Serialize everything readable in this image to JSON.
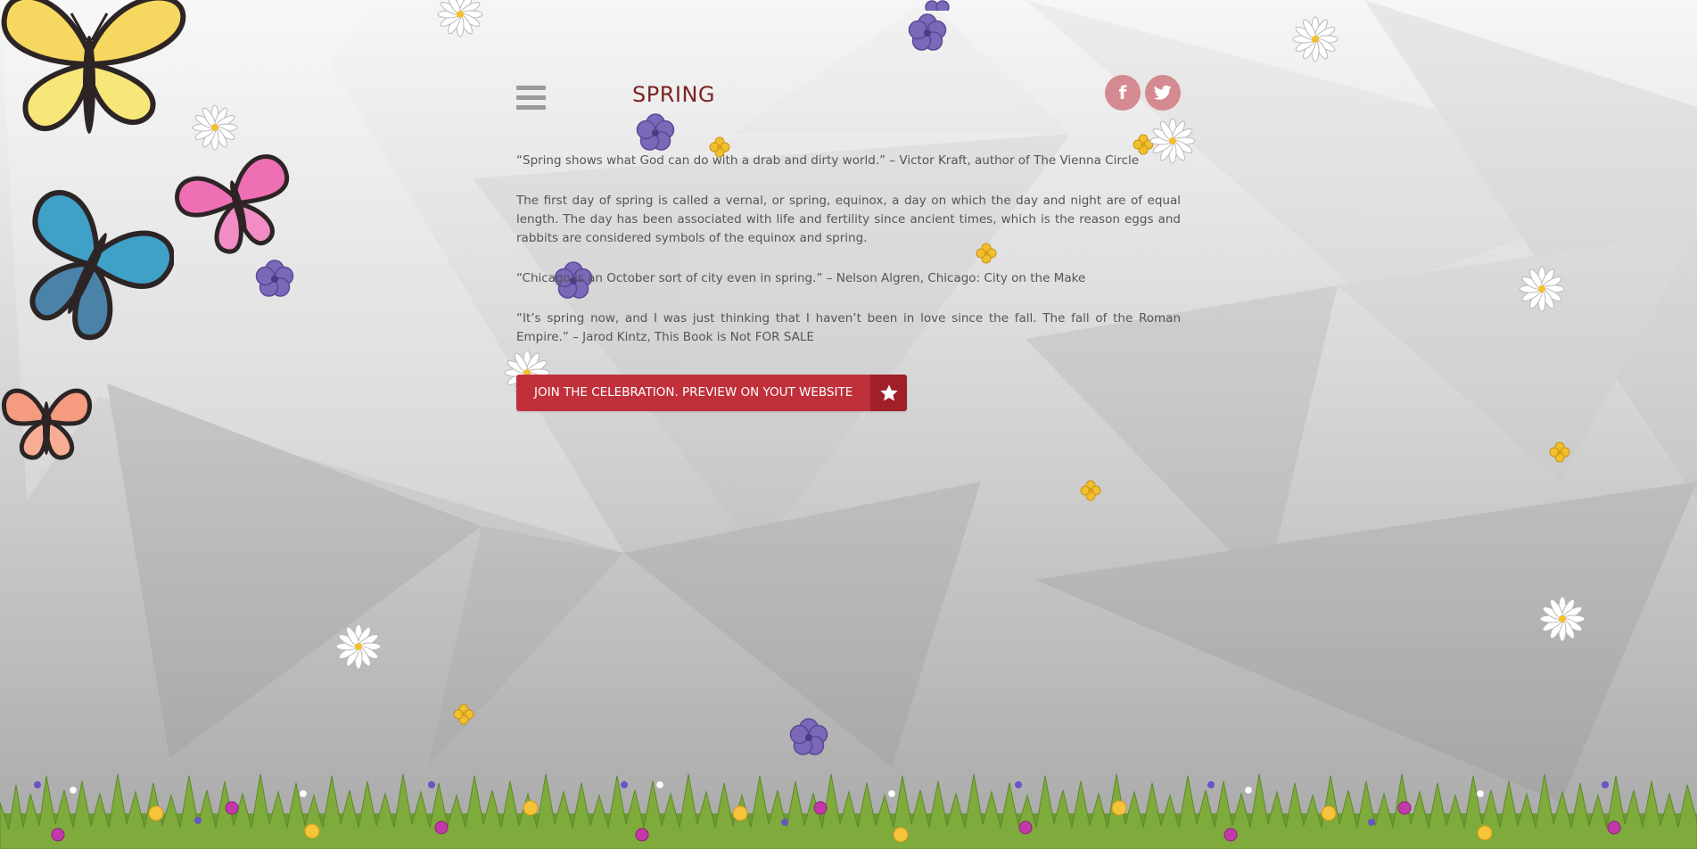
{
  "header": {
    "title": "SPRING",
    "menu_icon": "hamburger-menu-icon",
    "social": [
      {
        "name": "facebook",
        "icon": "facebook-icon",
        "glyph": "f"
      },
      {
        "name": "twitter",
        "icon": "twitter-icon"
      }
    ]
  },
  "content": {
    "paragraphs": [
      "“Spring shows what God can do with a drab and dirty world.” – Victor Kraft, author of The Vienna Circle",
      "The first day of spring is called a vernal, or spring, equinox, a day on which the day and night are of equal length. The day has been associated with life and fertility since ancient times, which is the reason eggs and rabbits are considered symbols of the equinox and spring.",
      "“Chicago is an October sort of city even in spring.” – Nelson Algren, Chicago: City on the Make",
      "“It’s spring now, and I was just thinking that I haven’t been in love since the fall. The fall of the Roman Empire.” – Jarod Kintz, This Book is Not FOR SALE"
    ]
  },
  "cta": {
    "label": "JOIN THE CELEBRATION. PREVIEW ON YOUT WEBSITE",
    "icon": "star-icon"
  },
  "colors": {
    "title": "#7a2424",
    "social_bg": "#d48a90",
    "cta_bg": "#c0303b",
    "cta_icon_bg": "#a01f29",
    "grass": "#6e9a34"
  },
  "decorations": {
    "butterflies": [
      "yellow-butterfly-icon",
      "pink-butterfly-icon",
      "blue-butterfly-icon",
      "orange-butterfly-icon"
    ],
    "flowers": [
      "purple-flower-icon",
      "yellow-flower-icon",
      "white-daisy-icon"
    ]
  }
}
